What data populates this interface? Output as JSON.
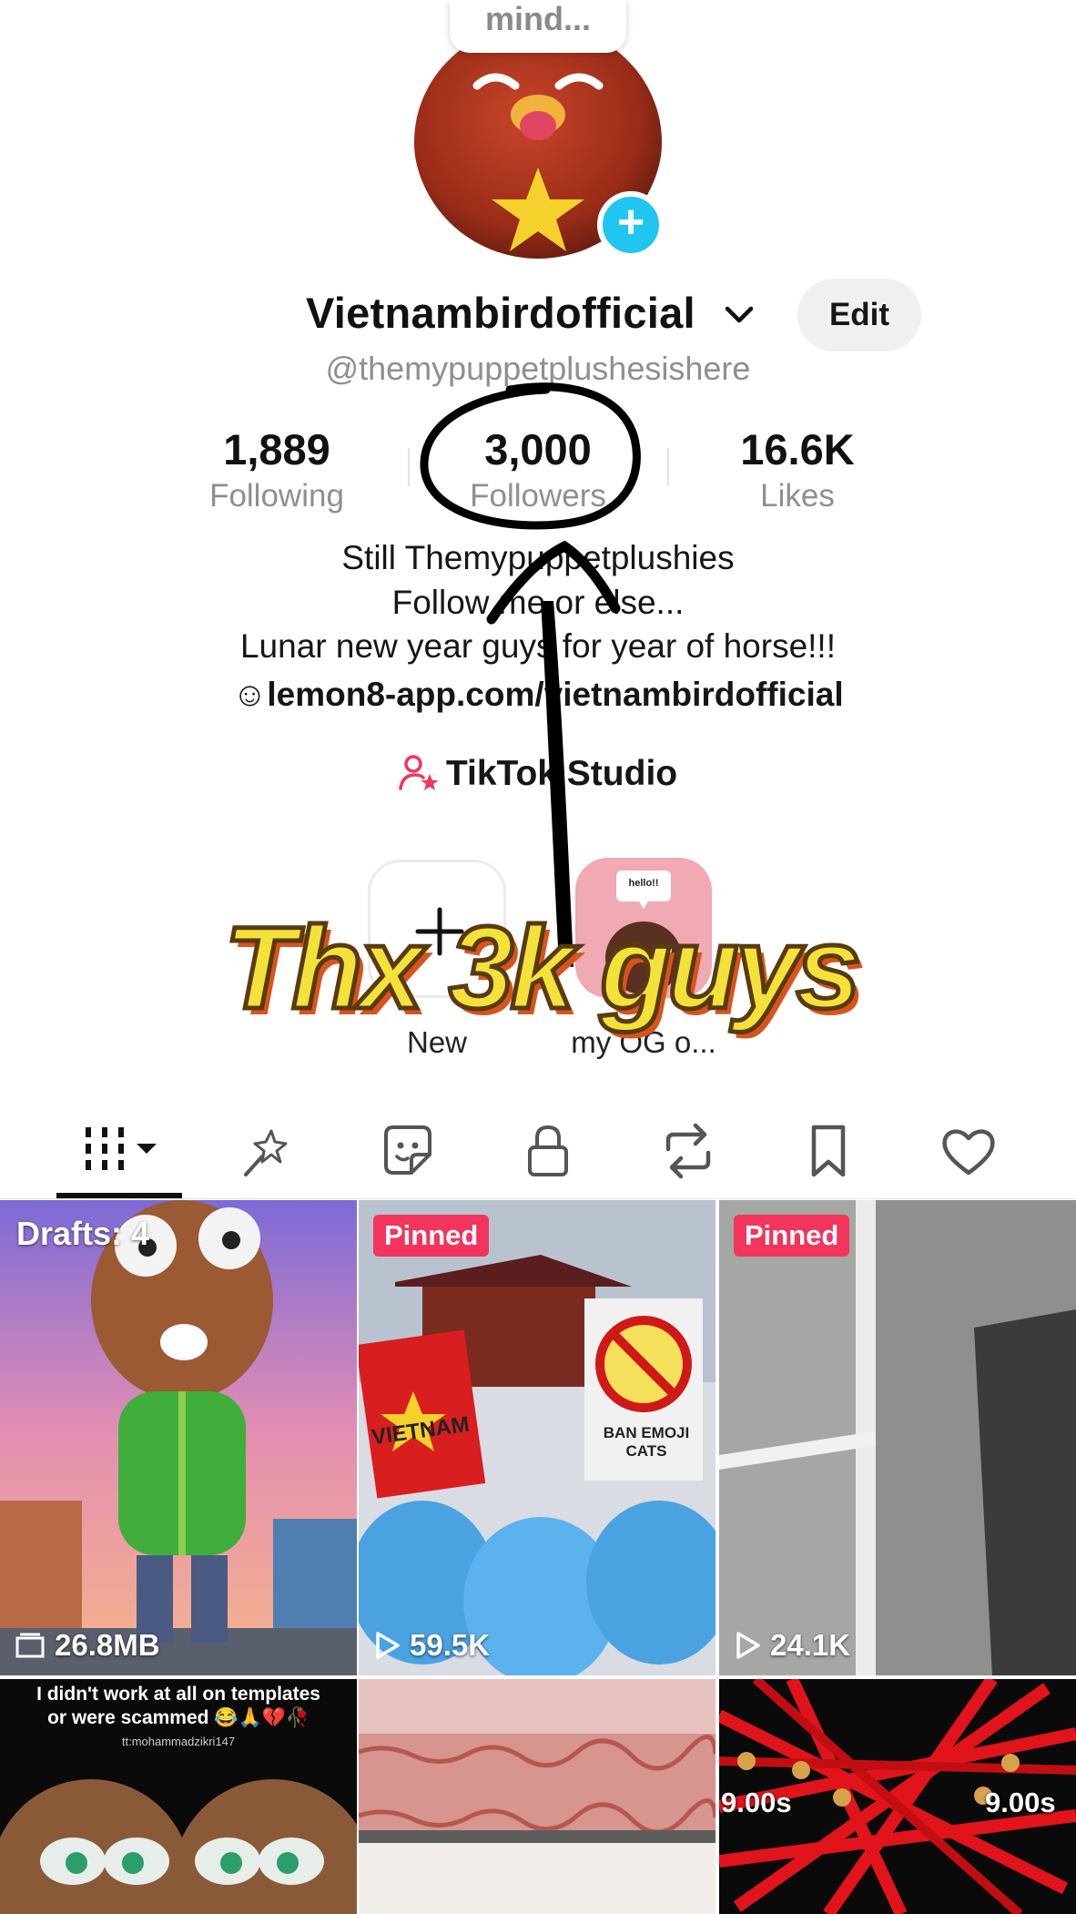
{
  "profile": {
    "thought_bubble": "mind...",
    "username": "Vietnambirdofficial",
    "handle": "@themypuppetplushesishere",
    "edit_label": "Edit"
  },
  "stats": [
    {
      "value": "1,889",
      "label": "Following"
    },
    {
      "value": "3,000",
      "label": "Followers"
    },
    {
      "value": "16.6K",
      "label": "Likes"
    }
  ],
  "bio": {
    "line1": "Still Themypuppetplushies",
    "line2": "Follow me or else...",
    "line3": "Lunar new year guys for year of horse!!!",
    "link": "lemon8-app.com/vietnambirdofficial",
    "studio": "TikTok Studio"
  },
  "highlights": {
    "new_label": "New",
    "og_label": "my OG o...",
    "og_bubble": "hello!!"
  },
  "overlay": {
    "caption": "Thx 3k guys"
  },
  "tabs": [
    "videos-tab",
    "effects-tab",
    "stickers-tab",
    "private-tab",
    "reposts-tab",
    "favorites-tab",
    "liked-tab"
  ],
  "grid": {
    "drafts_label": "Drafts: 4",
    "drafts_size": "26.8MB",
    "pinned_label": "Pinned",
    "tile2_views": "59.5K",
    "tile3_views": "24.1K",
    "tile2_sign_left": "VIETNAM",
    "tile2_sign_right": "BAN EMOJI CATS",
    "tile4_caption": "I didn't work at all on templates or were scammed 😂🙏💔🥀",
    "tile4_credit": "tt:mohammadzikri147",
    "tile6_timer": "9.00s"
  },
  "colors": {
    "accent_pink": "#f3345c",
    "avatar_add": "#20c5f0",
    "overlay_yellow": "#f4e23a",
    "overlay_shadow": "#d9531e"
  }
}
